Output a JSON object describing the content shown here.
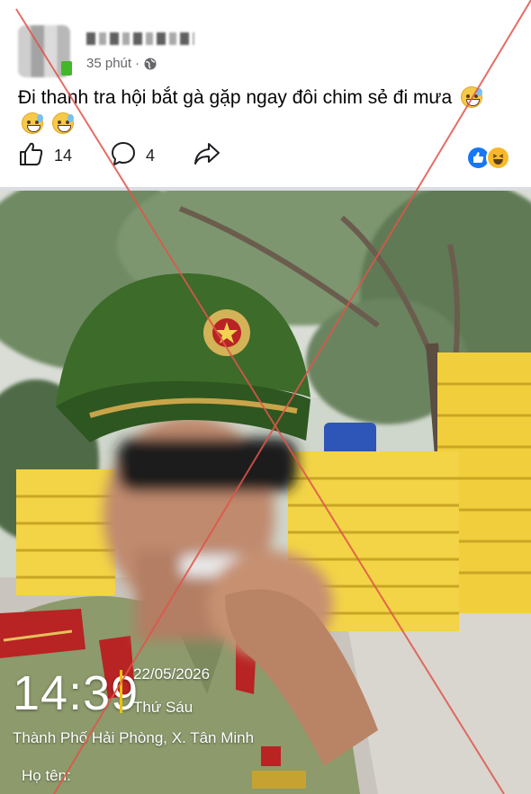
{
  "post": {
    "time": "35 phút",
    "separator": "·",
    "text": "Đi thanh tra hội bắt gà gặp ngay đôi chim sẻ đi mưa",
    "emojis": [
      "grin-sweat-emoji",
      "grin-sweat-emoji",
      "grin-sweat-emoji"
    ],
    "like_count": "14",
    "comment_count": "4"
  },
  "photo_overlay": {
    "time": "14:39",
    "date": "22/05/2026",
    "day": "Thứ Sáu",
    "location": "Thành Phố Hải Phòng, X. Tân Minh",
    "name_label": "Họ tên:"
  },
  "colors": {
    "text_primary": "#050505",
    "text_secondary": "#65676b",
    "like_blue": "#1877f2",
    "haha_yellow": "#f7b928",
    "watermark_red": "#e0554a",
    "overlay_accent": "#f2c200"
  },
  "icons": {
    "like": "thumbs-up-icon",
    "comment": "comment-bubble-icon",
    "share": "share-arrow-icon",
    "privacy": "globe-icon"
  }
}
